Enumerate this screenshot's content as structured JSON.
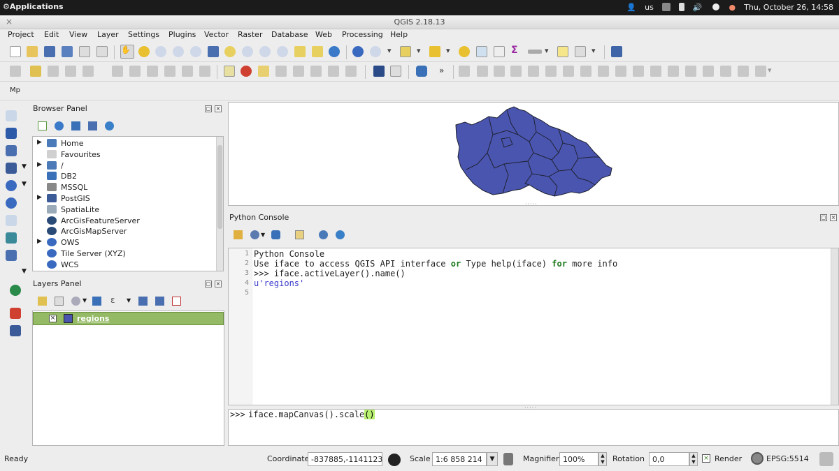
{
  "system_bar": {
    "apps_label": "Applications",
    "keyboard": "us",
    "datetime": "Thu, October 26, 14:58"
  },
  "window": {
    "title": "QGIS 2.18.13"
  },
  "menu": [
    "Project",
    "Edit",
    "View",
    "Layer",
    "Settings",
    "Plugins",
    "Vector",
    "Raster",
    "Database",
    "Web",
    "Processing",
    "Help"
  ],
  "browser_panel": {
    "title": "Browser Panel",
    "items": [
      {
        "label": "Home",
        "icon": "folder-icon",
        "expandable": true
      },
      {
        "label": "Favourites",
        "icon": "star-icon",
        "expandable": false
      },
      {
        "label": "/",
        "icon": "folder-icon",
        "expandable": true
      },
      {
        "label": "DB2",
        "icon": "db2-icon",
        "expandable": false
      },
      {
        "label": "MSSQL",
        "icon": "mssql-icon",
        "expandable": false
      },
      {
        "label": "PostGIS",
        "icon": "postgis-icon",
        "expandable": true
      },
      {
        "label": "SpatiaLite",
        "icon": "spatialite-icon",
        "expandable": false
      },
      {
        "label": "ArcGisFeatureServer",
        "icon": "arcgis-icon",
        "expandable": false
      },
      {
        "label": "ArcGisMapServer",
        "icon": "arcgis-icon",
        "expandable": false
      },
      {
        "label": "OWS",
        "icon": "globe-icon",
        "expandable": true
      },
      {
        "label": "Tile Server (XYZ)",
        "icon": "globe-icon",
        "expandable": false
      },
      {
        "label": "WCS",
        "icon": "globe-icon",
        "expandable": false
      }
    ]
  },
  "layers_panel": {
    "title": "Layers Panel",
    "layers": [
      {
        "name": "regions",
        "visible": true
      }
    ]
  },
  "python_console": {
    "title": "Python Console",
    "line_numbers": [
      "1",
      "2",
      "3",
      "4",
      "5"
    ],
    "line1": "Python Console",
    "line2_a": "Use iface to access QGIS API interface ",
    "line2_or": "or",
    "line2_b": " Type help(iface) ",
    "line2_for": "for",
    "line2_c": " more info",
    "line3": ">>> iface.activeLayer().name()",
    "line4": "u'regions'",
    "input_prompt": ">>>",
    "input_code": "iface.mapCanvas().scale",
    "input_parens": "()"
  },
  "toolbar_row3_label": "Mp",
  "status_bar": {
    "ready": "Ready",
    "coordinate_label": "Coordinate",
    "coordinate_value": "-837885,-1141123",
    "scale_label": "Scale",
    "scale_value": "1:6 858 214",
    "magnifier_label": "Magnifier",
    "magnifier_value": "100%",
    "rotation_label": "Rotation",
    "rotation_value": "0,0",
    "render_label": "Render",
    "crs": "EPSG:5514"
  },
  "colors": {
    "layer_fill": "#4a55b0",
    "layer_selected_bg": "#94ba65",
    "console_keyword": "#1b7a1b",
    "console_string": "#3b3bcc"
  }
}
